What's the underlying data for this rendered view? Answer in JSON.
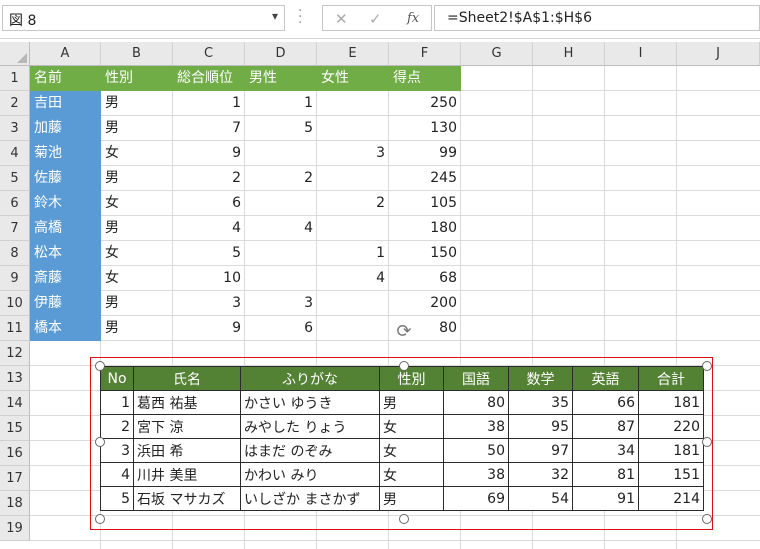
{
  "formula_bar": {
    "name_box": "図 8",
    "cancel_glyph": "✕",
    "enter_glyph": "✓",
    "fx_label": "fx",
    "formula": "=Sheet2!$A$1:$H$6"
  },
  "columns": [
    "A",
    "B",
    "C",
    "D",
    "E",
    "F",
    "G",
    "H",
    "I",
    "J"
  ],
  "rows": [
    "1",
    "2",
    "3",
    "4",
    "5",
    "6",
    "7",
    "8",
    "9",
    "10",
    "11",
    "12",
    "13",
    "14",
    "15",
    "16",
    "17",
    "18",
    "19"
  ],
  "sheet": {
    "headers": [
      "名前",
      "性別",
      "総合順位",
      "男性",
      "女性",
      "得点"
    ],
    "records": [
      {
        "name": "吉田",
        "gender": "男",
        "rank": "1",
        "male": "1",
        "female": "",
        "score": "250"
      },
      {
        "name": "加藤",
        "gender": "男",
        "rank": "7",
        "male": "5",
        "female": "",
        "score": "130"
      },
      {
        "name": "菊池",
        "gender": "女",
        "rank": "9",
        "male": "",
        "female": "3",
        "score": "99"
      },
      {
        "name": "佐藤",
        "gender": "男",
        "rank": "2",
        "male": "2",
        "female": "",
        "score": "245"
      },
      {
        "name": "鈴木",
        "gender": "女",
        "rank": "6",
        "male": "",
        "female": "2",
        "score": "105"
      },
      {
        "name": "高橋",
        "gender": "男",
        "rank": "4",
        "male": "4",
        "female": "",
        "score": "180"
      },
      {
        "name": "松本",
        "gender": "女",
        "rank": "5",
        "male": "",
        "female": "1",
        "score": "150"
      },
      {
        "name": "斎藤",
        "gender": "女",
        "rank": "10",
        "male": "",
        "female": "4",
        "score": "68"
      },
      {
        "name": "伊藤",
        "gender": "男",
        "rank": "3",
        "male": "3",
        "female": "",
        "score": "200"
      },
      {
        "name": "橋本",
        "gender": "男",
        "rank": "9",
        "male": "6",
        "female": "",
        "score": "80"
      }
    ]
  },
  "picture": {
    "headers": [
      "No",
      "氏名",
      "ふりがな",
      "性別",
      "国語",
      "数学",
      "英語",
      "合計"
    ],
    "rows": [
      [
        "1",
        "葛西 祐基",
        "かさい ゆうき",
        "男",
        "80",
        "35",
        "66",
        "181"
      ],
      [
        "2",
        "宮下 涼",
        "みやした りょう",
        "女",
        "38",
        "95",
        "87",
        "220"
      ],
      [
        "3",
        "浜田 希",
        "はまだ のぞみ",
        "女",
        "50",
        "97",
        "34",
        "181"
      ],
      [
        "4",
        "川井 美里",
        "かわい みり",
        "女",
        "38",
        "32",
        "81",
        "151"
      ],
      [
        "5",
        "石坂 マサカズ",
        "いしざか まさかず",
        "男",
        "69",
        "54",
        "91",
        "214"
      ]
    ]
  },
  "colors": {
    "header_green": "#70ad47",
    "name_blue": "#5b9bd5",
    "picture_header_green": "#548235",
    "selection_red": "#dd1111"
  },
  "icons": {
    "rotate": "rotate-handle-icon",
    "dropdown": "chevron-down-icon"
  }
}
